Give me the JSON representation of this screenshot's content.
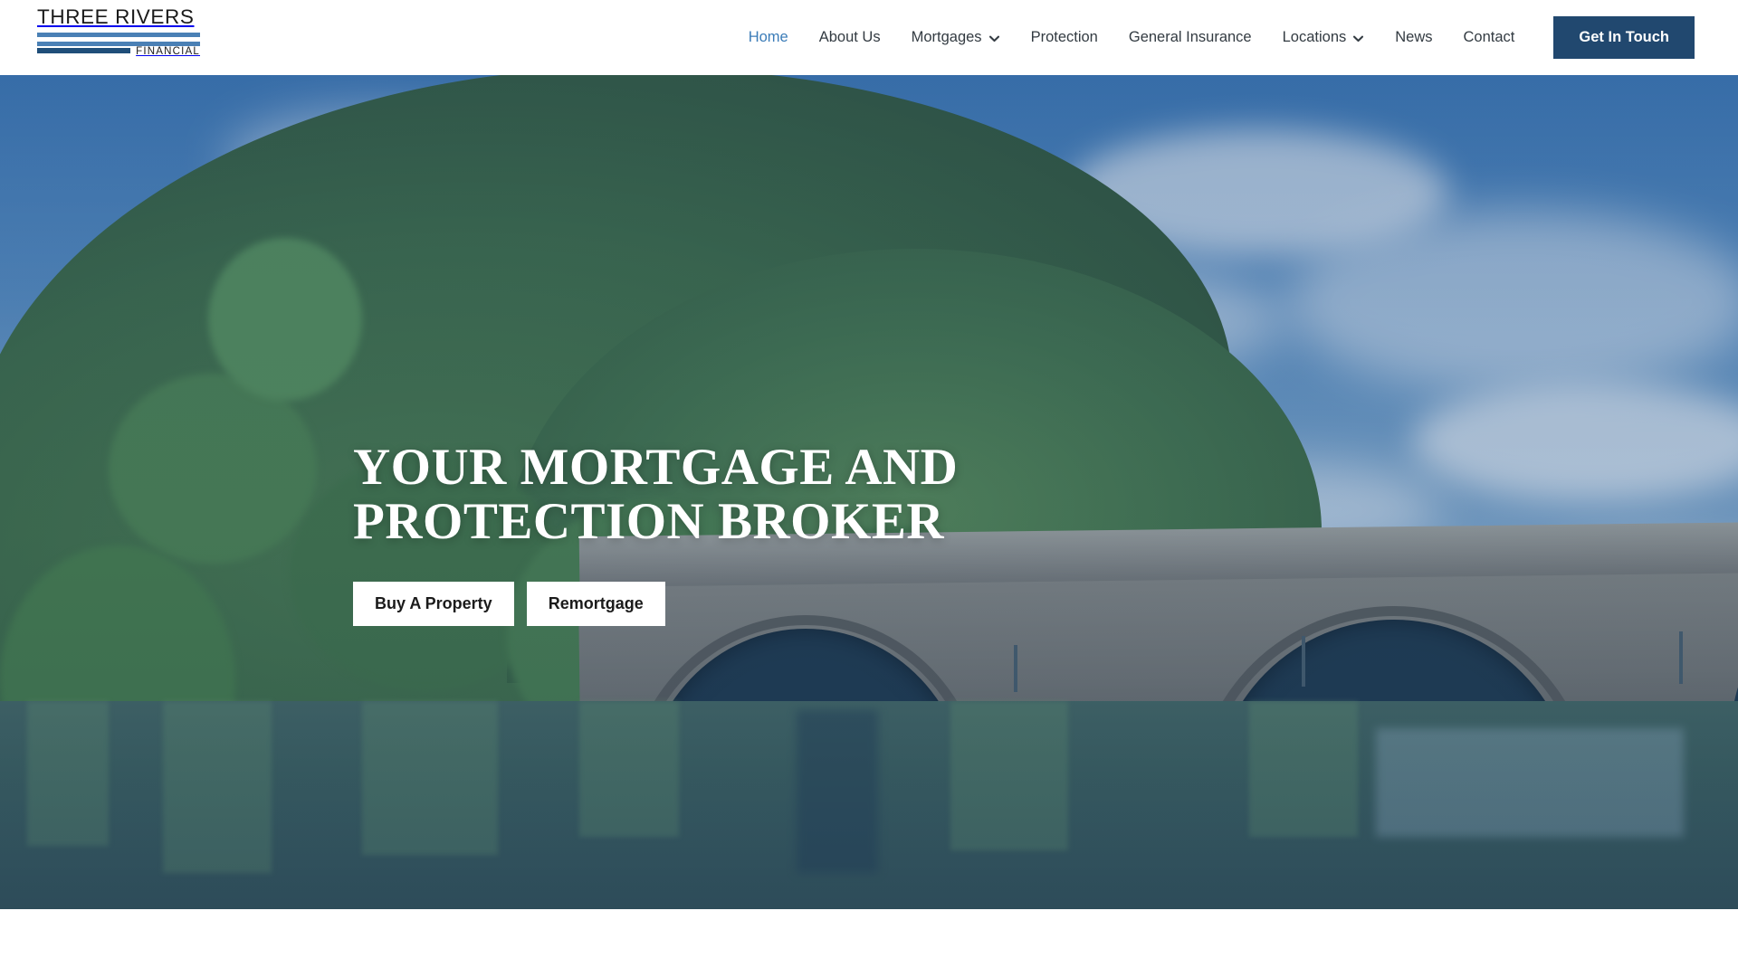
{
  "header": {
    "logo": {
      "name_line": "THREE RIVERS",
      "sub_line": "FINANCIAL",
      "bar_color_light": "#4a80b5",
      "bar_color_dark": "#1f4e79"
    },
    "nav_items": [
      {
        "label": "Home",
        "active": true,
        "has_dropdown": false
      },
      {
        "label": "About Us",
        "active": false,
        "has_dropdown": false
      },
      {
        "label": "Mortgages",
        "active": false,
        "has_dropdown": true
      },
      {
        "label": "Protection",
        "active": false,
        "has_dropdown": false
      },
      {
        "label": "General Insurance",
        "active": false,
        "has_dropdown": false
      },
      {
        "label": "Locations",
        "active": false,
        "has_dropdown": true
      },
      {
        "label": "News",
        "active": false,
        "has_dropdown": false
      },
      {
        "label": "Contact",
        "active": false,
        "has_dropdown": false
      }
    ],
    "cta_label": "Get In Touch",
    "cta_color": "#21486f",
    "active_link_color": "#3b7cb8",
    "link_color": "#333b42"
  },
  "hero": {
    "title": "YOUR MORTGAGE AND\nPROTECTION BROKER",
    "title_line_1": "YOUR MORTGAGE AND",
    "title_line_2": "PROTECTION BROKER",
    "buttons": [
      {
        "label": "Buy A Property"
      },
      {
        "label": "Remortgage"
      }
    ],
    "background_description": "Durham Castle and Cathedral above Framwellgate Bridge over the River Wear, blue-tinted photograph",
    "overlay_tint": "#285082",
    "text_color": "#ffffff",
    "button_bg": "#ffffff",
    "button_text_color": "#1b1b1b"
  }
}
